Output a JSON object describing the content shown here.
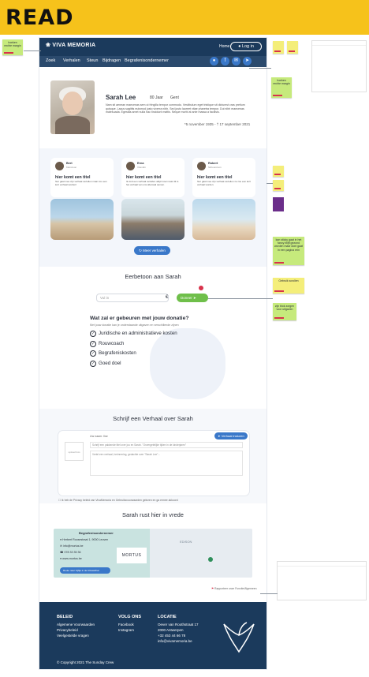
{
  "banner": {
    "title": "READ"
  },
  "header": {
    "logo": "VIVA MEMORIA",
    "home": "Home",
    "login": "Log in"
  },
  "nav": {
    "items": [
      "Zoek",
      "Verhalen",
      "Steun",
      "Bijdragen",
      "Begrafenisondernemer"
    ]
  },
  "share": {
    "icons": [
      "user-icon",
      "facebook-icon",
      "mail-icon",
      "share-icon"
    ]
  },
  "profile": {
    "name": "Sarah Lee",
    "age": "80 Jaar",
    "city": "Gent",
    "bio": "Nam sit aenean maecenas sem ut fringilla tempor commodo. Vestibulum eget tristique sit dictumst cras pretium quisque. Lacus sagittis euismod justo viverra nibh. Sed justo laoreet vitae pharetra tempor. Dui nibh maecenas malesuada. Egestas amet nulla hac tincidunt mattis. Neque morbi at ante massa a facilisis.",
    "dates": "*5 november 1935 - † 17 september 2021"
  },
  "stories": {
    "cards": [
      {
        "name": "Bert",
        "sub": "Kleinzoon",
        "title": "hier komt een titel",
        "text": "hier gaat mee zijn verhaal vertellen maar zou een kort verhaal worden!"
      },
      {
        "name": "Erna",
        "sub": "Vriendin",
        "title": "hier komt een titel",
        "text": "Ik vind een verhaal vertellen altijd mooi maar dit is het verhaal van ons allemaal samen."
      },
      {
        "name": "Robert",
        "sub": "Schoonzoon",
        "title": "hier komt een titel",
        "text": "hier gaat mee zijn verhaal vertellen ze zou een kort verhaal worden."
      }
    ],
    "more_button": "Meer verhalen"
  },
  "donate": {
    "heading": "Eerbetoon aan Sarah",
    "placeholder": "Vul in",
    "currency": "€",
    "button": "Doneer",
    "question": "Wat zal er gebeuren met jouw donatie?",
    "subtext": "Met jouw donatie kan je onderstaande uitgaven en verschillende zijnen",
    "items": [
      "Juridische en administratieve kosten",
      "Rouwcoach",
      "Begrafeniskosten",
      "Goed doel"
    ]
  },
  "write": {
    "heading": "Schrijf een Verhaal over Sarah",
    "name_label": "Uw naam: Ilse",
    "title_placeholder": "Schrijf een pakkende titel over jou en Sarah. \"Onvergetelijke tijden in de kinderjaren\"",
    "text_placeholder": "Vertel een verhaal, herinnering, gedachte over \"Sarah Lee\"...",
    "button": "Verhaal insturen",
    "avatar_label": "upload foto",
    "consent": "Ik heb de Privacy beleid van VivaMemoria en Gebruiksvoorwaarden gelezen en ga ermee akkoord"
  },
  "rest": {
    "heading": "Sarah rust hier in vrede",
    "card_title": "Begrafenisondernemer",
    "address": "Herbert Roosestraat 1, 9000 Leuven",
    "email": "info@mortus.be",
    "phone": "078 33 35 36",
    "website": "www.mortus.be",
    "route_button": "Route naar Vijftje in de Uitvaarthal",
    "brand": "MORTUS",
    "map_label": "EDISON",
    "flag_link": "Rapporteer onze Functie/Algemeen"
  },
  "footer": {
    "beleid": {
      "title": "BELEID",
      "items": [
        "Algemene Voorwaarden",
        "Privacybeleid",
        "Veelgestelde vragen"
      ]
    },
    "volg": {
      "title": "VOLG ONS",
      "items": [
        "Facebook",
        "Instagram"
      ]
    },
    "locatie": {
      "title": "LOCATIE",
      "items": [
        "Oever van Roothstraat 17",
        "2000 Antwerpen",
        "+32 453 44 66 78",
        "info@vivamemoria.be"
      ]
    },
    "copyright": "© Copyright 2021 The Sunday Crew"
  },
  "notes": {
    "n1": "hoeken rechte margin",
    "n2": "hoeken rechte margin",
    "n3": "kan sticky gaat in het fancy blijft gezond worden maar dont gaat in een pagina erin",
    "n4": "Gebruik scrollen",
    "n5": "zijn blok zorgen voor uitgaven"
  }
}
